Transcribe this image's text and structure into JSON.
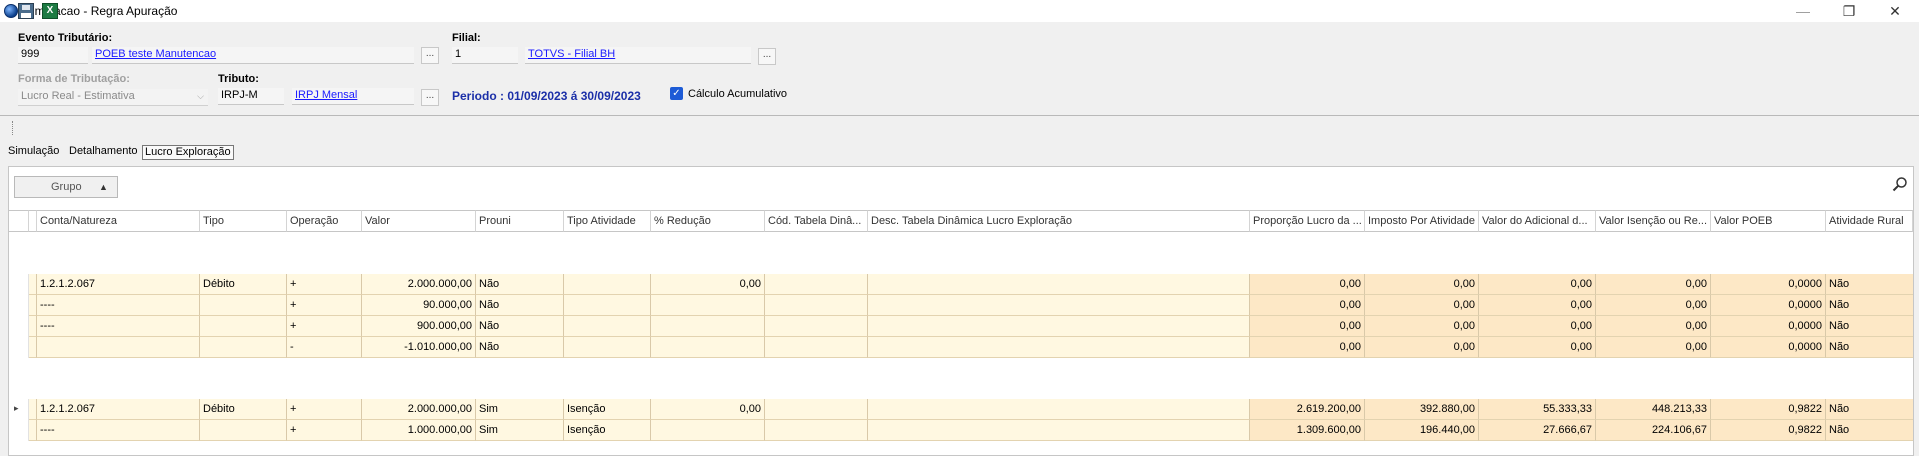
{
  "window": {
    "title": "Simulacao - Regra Apuração",
    "min_glyph": "—",
    "max_glyph": "❐",
    "close_glyph": "✕"
  },
  "header": {
    "evento_label": "Evento Tributário:",
    "evento_code": "999",
    "evento_desc": "POEB teste Manutencao",
    "filial_label": "Filial:",
    "filial_code": "1",
    "filial_desc": "TOTVS - Filial BH",
    "forma_label": "Forma de Tributação:",
    "forma_value": "Lucro Real - Estimativa",
    "tributo_label": "Tributo:",
    "tributo_code": "IRPJ-M",
    "tributo_desc": "IRPJ Mensal",
    "lookup": "...",
    "periodo": "Periodo : 01/09/2023 á 30/09/2023",
    "calculo_label": "Cálculo Acumulativo",
    "calculo_checked": true
  },
  "toolbar": {
    "save_icon": "save-icon",
    "excel_icon": "excel-icon",
    "excel_glyph": "X"
  },
  "tabs": [
    "Simulação",
    "Detalhamento",
    "Lucro Exploração"
  ],
  "grid": {
    "group_button": "Grupo",
    "group_arrow": "▲",
    "columns": [
      "Conta/Natureza",
      "Tipo",
      "Operação",
      "Valor",
      "Prouni",
      "Tipo Atividade",
      "% Redução",
      "Cód. Tabela Dinâ...",
      "Desc. Tabela Dinâmica Lucro Exploração",
      "Proporção Lucro da ...",
      "Imposto Por Atividade",
      "Valor do Adicional d...",
      "Valor Isenção ou Re...",
      "Valor POEB",
      "Atividade Rural"
    ],
    "group1": [
      [
        "1.2.1.2.067",
        "Débito",
        "+",
        "2.000.000,00",
        "Não",
        "",
        "0,00",
        "",
        "",
        "0,00",
        "0,00",
        "0,00",
        "0,00",
        "0,0000",
        "Não"
      ],
      [
        "----",
        "",
        "+",
        "90.000,00",
        "Não",
        "",
        "",
        "",
        "",
        "0,00",
        "0,00",
        "0,00",
        "0,00",
        "0,0000",
        "Não"
      ],
      [
        "----",
        "",
        "+",
        "900.000,00",
        "Não",
        "",
        "",
        "",
        "",
        "0,00",
        "0,00",
        "0,00",
        "0,00",
        "0,0000",
        "Não"
      ],
      [
        "",
        "",
        "-",
        "-1.010.000,00",
        "Não",
        "",
        "",
        "",
        "",
        "0,00",
        "0,00",
        "0,00",
        "0,00",
        "0,0000",
        "Não"
      ]
    ],
    "group2": [
      [
        "1.2.1.2.067",
        "Débito",
        "+",
        "2.000.000,00",
        "Sim",
        "Isenção",
        "0,00",
        "",
        "",
        "2.619.200,00",
        "392.880,00",
        "55.333,33",
        "448.213,33",
        "0,9822",
        "Não"
      ],
      [
        "----",
        "",
        "+",
        "1.000.000,00",
        "Sim",
        "Isenção",
        "",
        "",
        "",
        "1.309.600,00",
        "196.440,00",
        "27.666,67",
        "224.106,67",
        "0,9822",
        "Não"
      ]
    ],
    "row_pointer": "▸"
  }
}
